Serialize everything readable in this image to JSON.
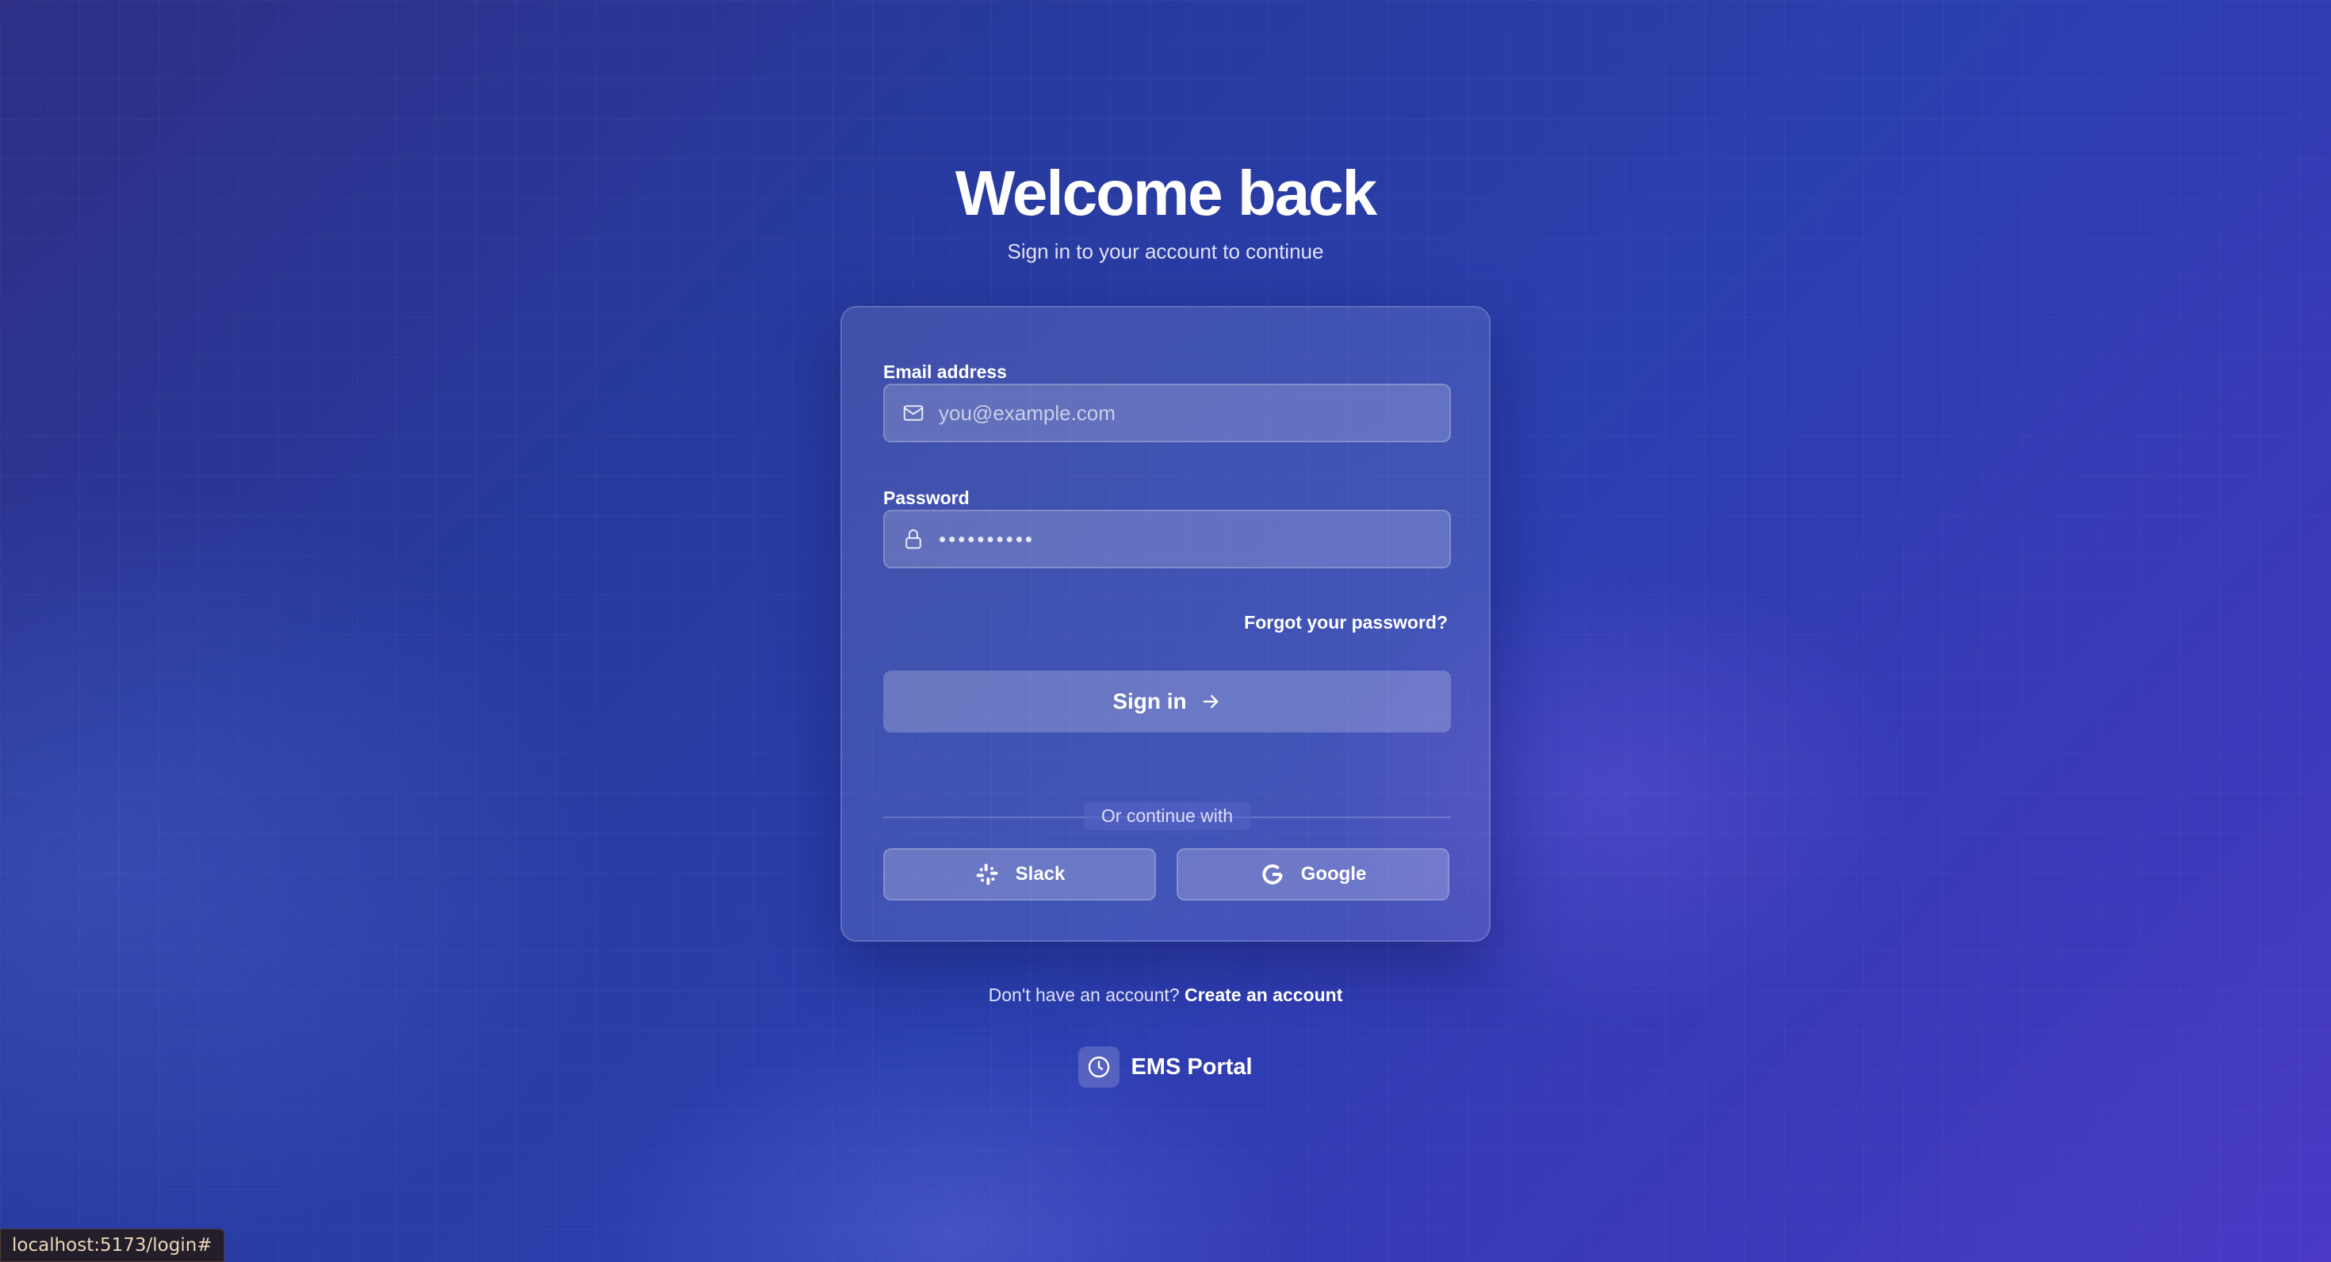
{
  "header": {
    "title": "Welcome back",
    "subtitle": "Sign in to your account to continue"
  },
  "form": {
    "email_label": "Email address",
    "email_placeholder": "you@example.com",
    "email_value": "",
    "password_label": "Password",
    "password_masked": "••••••••••",
    "forgot_link": "Forgot your password?",
    "submit_label": "Sign in",
    "divider_text": "Or continue with",
    "providers": [
      {
        "label": "Slack",
        "icon": "slack-icon"
      },
      {
        "label": "Google",
        "icon": "google-icon"
      }
    ]
  },
  "footer": {
    "prompt": "Don't have an account?",
    "create_link": "Create an account",
    "brand_name": "EMS Portal",
    "brand_icon": "clock-icon"
  },
  "statusbar": {
    "url": "localhost:5173/login#"
  }
}
